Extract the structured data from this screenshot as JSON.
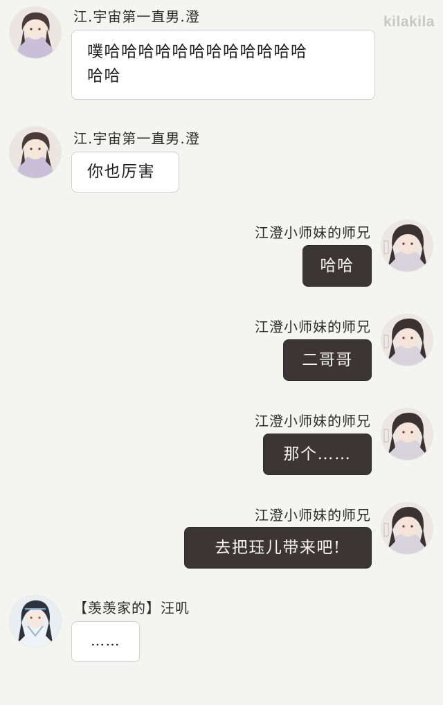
{
  "watermark": "kilakila",
  "messages": [
    {
      "side": "left",
      "avatar": "avatar-jiang-cheng",
      "sender": "江.宇宙第一直男.澄",
      "lines": [
        "噗哈哈哈哈哈哈哈哈哈哈哈哈",
        "哈哈"
      ]
    },
    {
      "side": "left",
      "avatar": "avatar-jiang-cheng",
      "sender": "江.宇宙第一直男.澄",
      "lines": [
        "你也厉害"
      ]
    },
    {
      "side": "right",
      "avatar": "avatar-shixiong",
      "sender": "江澄小师妹的师兄",
      "lines": [
        "哈哈"
      ]
    },
    {
      "side": "right",
      "avatar": "avatar-shixiong",
      "sender": "江澄小师妹的师兄",
      "lines": [
        "二哥哥"
      ]
    },
    {
      "side": "right",
      "avatar": "avatar-shixiong",
      "sender": "江澄小师妹的师兄",
      "lines": [
        "那个……"
      ]
    },
    {
      "side": "right",
      "avatar": "avatar-shixiong",
      "sender": "江澄小师妹的师兄",
      "lines": [
        "去把珏儿带来吧!"
      ]
    },
    {
      "side": "left",
      "avatar": "avatar-wangji",
      "sender": "【羡羡家的】汪叽",
      "lines": [
        "……"
      ]
    }
  ]
}
